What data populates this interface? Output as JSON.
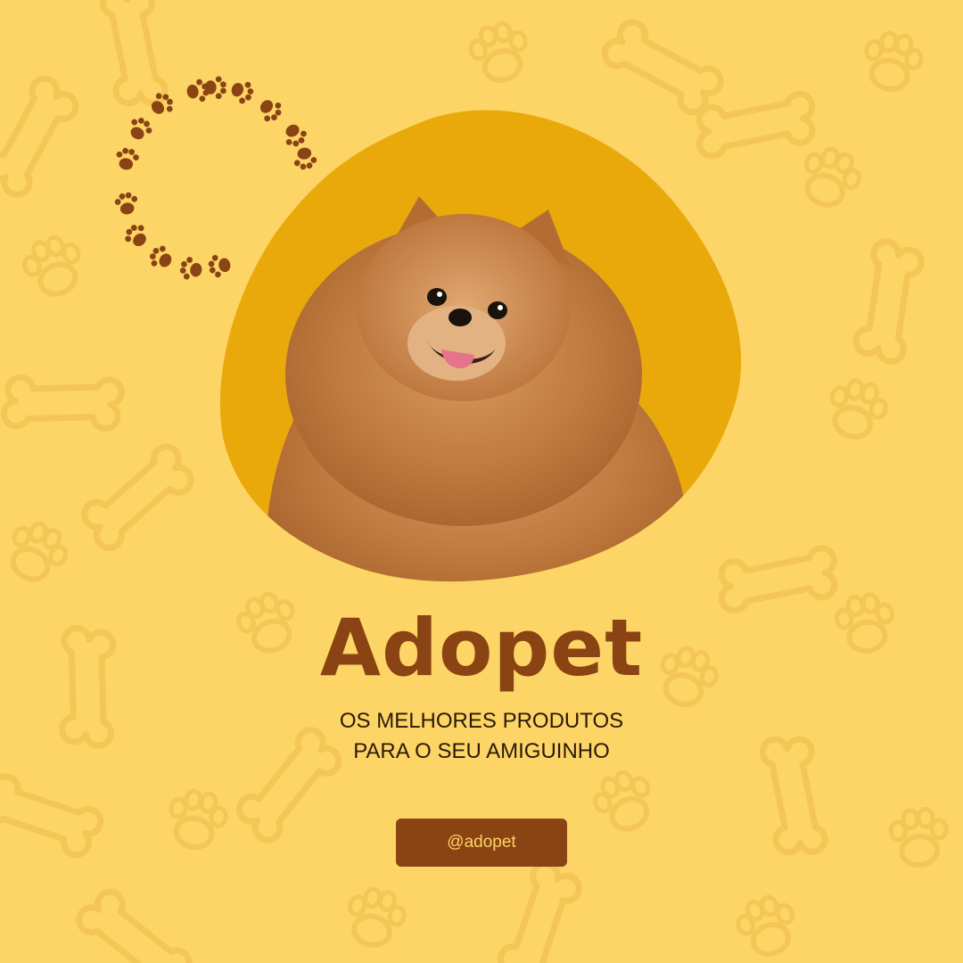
{
  "brand": {
    "name": "Adopet"
  },
  "tagline": {
    "line1": "OS MELHORES PRODUTOS",
    "line2": "PARA O SEU AMIGUINHO"
  },
  "cta": {
    "label": "@adopet"
  },
  "colors": {
    "background": "#fdd466",
    "blob": "#eaa90b",
    "brand_brown": "#8a4312",
    "text_dark": "#2a1a08"
  },
  "icons": {
    "background_pattern": "paw-and-bone-pattern-icon",
    "ring": "paw-print-ring-icon",
    "photo": "pomeranian-dog-photo"
  }
}
